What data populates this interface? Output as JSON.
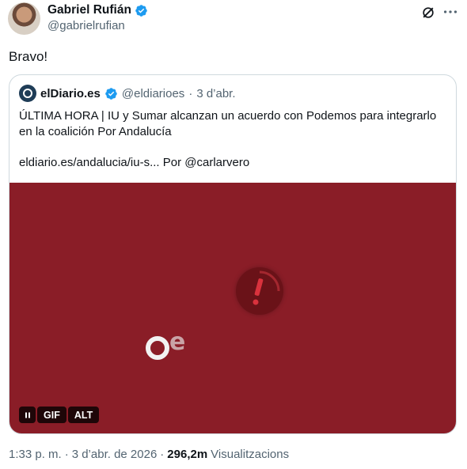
{
  "author": {
    "display_name": "Gabriel Rufián",
    "handle": "@gabrielrufian"
  },
  "tweet": {
    "text": "Bravo!"
  },
  "quote": {
    "display_name": "elDiario.es",
    "handle": "@eldiarioes",
    "separator": "·",
    "date": "3 d’abr.",
    "text": "ÚLTIMA HORA | IU y Sumar alcanzan un acuerdo con Podemos para integrarlo en la coalición Por Andalucía",
    "link_text": "eldiario.es/andalucia/iu-s... Por @carlarvero",
    "media": {
      "background_color": "#8a1d27",
      "brand_letter": "e",
      "controls": {
        "pause_label": "II",
        "gif_label": "GIF",
        "alt_label": "ALT"
      }
    }
  },
  "meta": {
    "time": "1:33 p. m.",
    "sep1": "·",
    "date": "3 d’abr. de 2026",
    "sep2": "·",
    "views_count": "296,2m",
    "views_label": "Visualitzacions"
  },
  "colors": {
    "verified": "#1d9bf0",
    "text_primary": "#0f1419",
    "text_secondary": "#536471",
    "card_border": "#cfd9de"
  },
  "icons": [
    "verified-badge-icon",
    "grok-icon",
    "more-icon",
    "pause-icon"
  ]
}
